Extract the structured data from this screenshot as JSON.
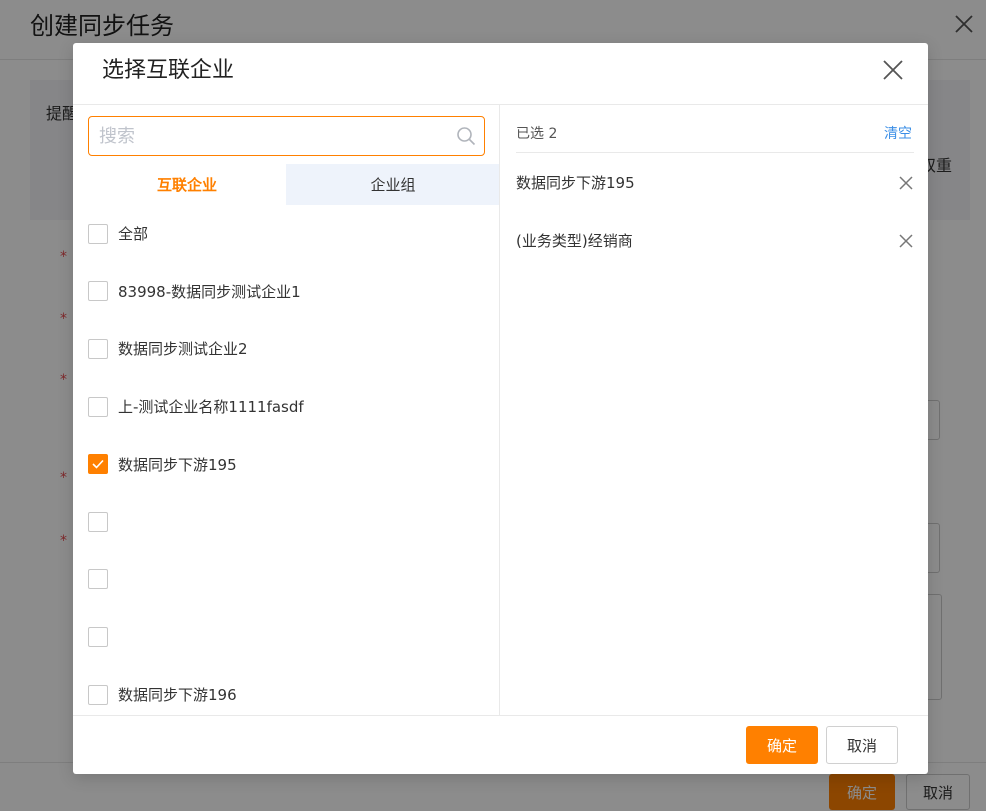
{
  "background": {
    "title": "创建同步任务",
    "notice_label": "提醒",
    "notice_tail": "双重",
    "ok_label": "确定",
    "cancel_label": "取消"
  },
  "modal": {
    "title": "选择互联企业",
    "search": {
      "placeholder": "搜索",
      "value": ""
    },
    "tabs": [
      {
        "label": "互联企业",
        "active": true
      },
      {
        "label": "企业组",
        "active": false
      }
    ],
    "items": [
      {
        "label": "全部",
        "checked": false
      },
      {
        "label": "83998-数据同步测试企业1",
        "checked": false
      },
      {
        "label": "数据同步测试企业2",
        "checked": false
      },
      {
        "label": "上-测试企业名称1111fasdf",
        "checked": false
      },
      {
        "label": "数据同步下游195",
        "checked": true
      },
      {
        "label": "",
        "checked": false
      },
      {
        "label": "",
        "checked": false
      },
      {
        "label": "",
        "checked": false
      },
      {
        "label": "数据同步下游196",
        "checked": false
      }
    ],
    "selected": {
      "count_label": "已选 2",
      "clear_label": "清空",
      "items": [
        {
          "label": "数据同步下游195"
        },
        {
          "label": "(业务类型)经销商"
        }
      ]
    },
    "confirm_label": "确定",
    "cancel_label": "取消"
  },
  "colors": {
    "accent": "#ff8000",
    "link": "#3a8ee6",
    "tab_inactive_bg": "#eef3fb"
  }
}
